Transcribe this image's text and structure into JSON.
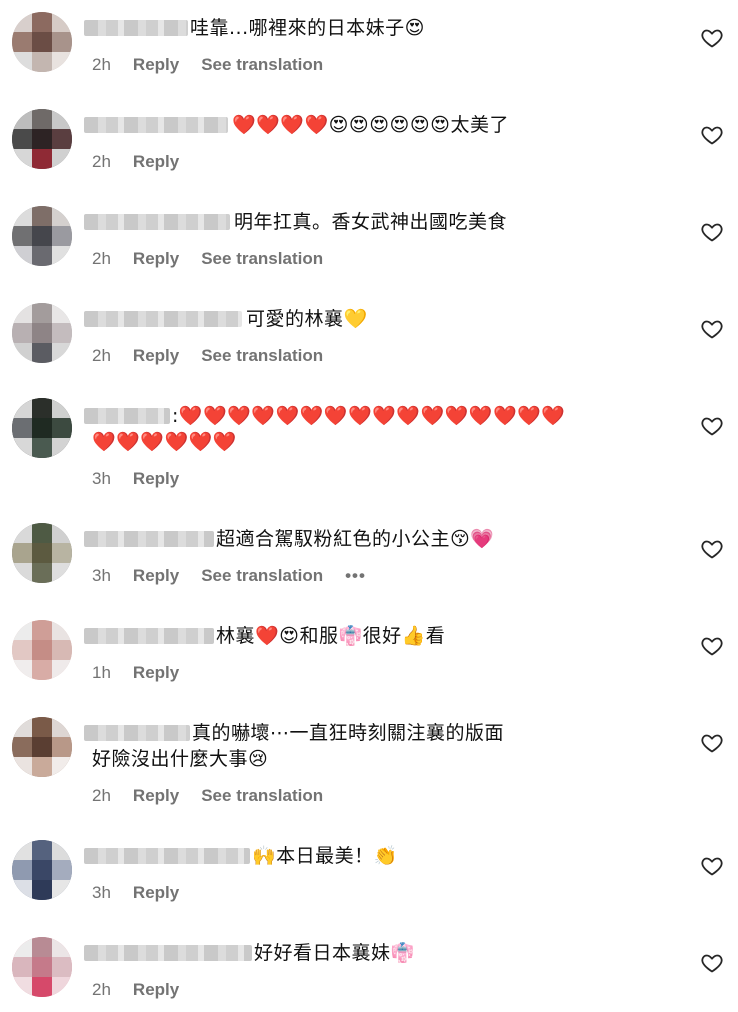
{
  "comments": [
    {
      "text": "哇靠...哪裡來的日本妹子😍",
      "time": "2h",
      "reply": "Reply",
      "translate": "See translation"
    },
    {
      "text": "❤️❤️❤️❤️😍😍😍😍😍😍太美了",
      "time": "2h",
      "reply": "Reply"
    },
    {
      "text": "明年扛真。香女武神出國吃美食",
      "time": "2h",
      "reply": "Reply",
      "translate": "See translation"
    },
    {
      "text": "可愛的林襄💛",
      "time": "2h",
      "reply": "Reply",
      "translate": "See translation"
    },
    {
      "text": ":❤️❤️❤️❤️❤️❤️❤️❤️❤️❤️❤️❤️❤️❤️❤️❤️",
      "text2": "❤️❤️❤️❤️❤️❤️",
      "time": "3h",
      "reply": "Reply"
    },
    {
      "text": "超適合駕馭粉紅色的小公主😚💗",
      "time": "3h",
      "reply": "Reply",
      "translate": "See translation",
      "more": "•••"
    },
    {
      "text": "林襄❤️😍和服👘很好👍看",
      "time": "1h",
      "reply": "Reply"
    },
    {
      "text": "真的嚇壞⋯一直狂時刻關注襄的版面",
      "text2": "好險沒出什麼大事😢",
      "time": "2h",
      "reply": "Reply",
      "translate": "See translation"
    },
    {
      "text": "🙌本日最美！👏",
      "time": "3h",
      "reply": "Reply"
    },
    {
      "text": "好好看日本襄妹👘",
      "time": "2h",
      "reply": "Reply"
    }
  ]
}
